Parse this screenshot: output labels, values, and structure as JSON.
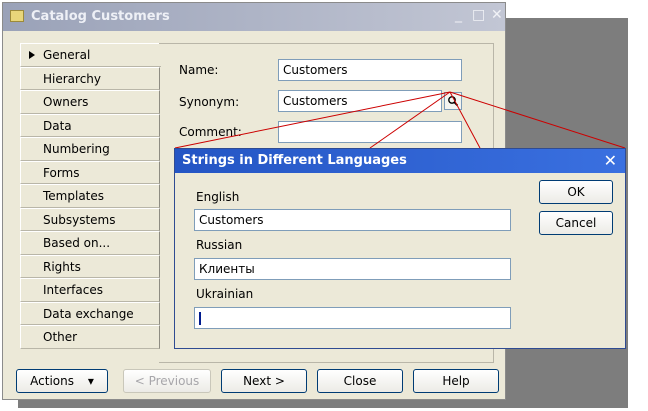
{
  "window": {
    "title": "Catalog Customers",
    "minimize_glyph": "_",
    "maximize_glyph": "□",
    "close_glyph": "✕"
  },
  "tabs": [
    {
      "label": "General",
      "active": true
    },
    {
      "label": "Hierarchy"
    },
    {
      "label": "Owners"
    },
    {
      "label": "Data"
    },
    {
      "label": "Numbering"
    },
    {
      "label": "Forms"
    },
    {
      "label": "Templates"
    },
    {
      "label": "Subsystems"
    },
    {
      "label": "Based on..."
    },
    {
      "label": "Rights"
    },
    {
      "label": "Interfaces"
    },
    {
      "label": "Data exchange"
    },
    {
      "label": "Other"
    }
  ],
  "form": {
    "name_label": "Name:",
    "name_value": "Customers",
    "synonym_label": "Synonym:",
    "synonym_value": "Customers",
    "comment_label": "Comment:",
    "comment_value": "",
    "search_icon": "magnifier-icon",
    "search_glyph": "🔍"
  },
  "buttons": {
    "actions": "Actions",
    "actions_arrow": "▾",
    "previous": "< Previous",
    "next": "Next >",
    "close": "Close",
    "help": "Help"
  },
  "dialog": {
    "title": "Strings in Different Languages",
    "close_glyph": "✕",
    "ok": "OK",
    "cancel": "Cancel",
    "languages": [
      {
        "label": "English",
        "value": "Customers"
      },
      {
        "label": "Russian",
        "value": "Клиенты"
      },
      {
        "label": "Ukrainian",
        "value": ""
      }
    ]
  },
  "colors": {
    "dialog_title_bar": "#2455c4",
    "window_title_bar_inactive": "#9aa2b8",
    "connector_lines": "#cc0000",
    "face": "#ece9d8"
  }
}
